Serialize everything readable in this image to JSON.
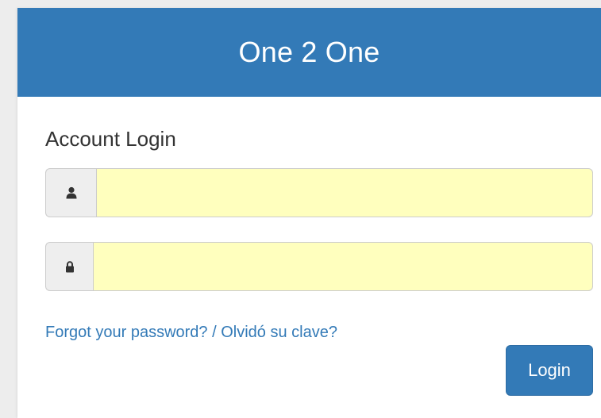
{
  "header": {
    "title": "One 2 One"
  },
  "form": {
    "heading": "Account Login",
    "username": {
      "icon": "user-icon",
      "value": "",
      "placeholder": ""
    },
    "password": {
      "icon": "lock-icon",
      "value": "",
      "placeholder": ""
    },
    "forgot_link": "Forgot your password? / Olvidó su clave?",
    "login_label": "Login"
  },
  "colors": {
    "primary": "#337ab7",
    "autofill_background": "#ffffbe",
    "page_background": "#ededed"
  }
}
